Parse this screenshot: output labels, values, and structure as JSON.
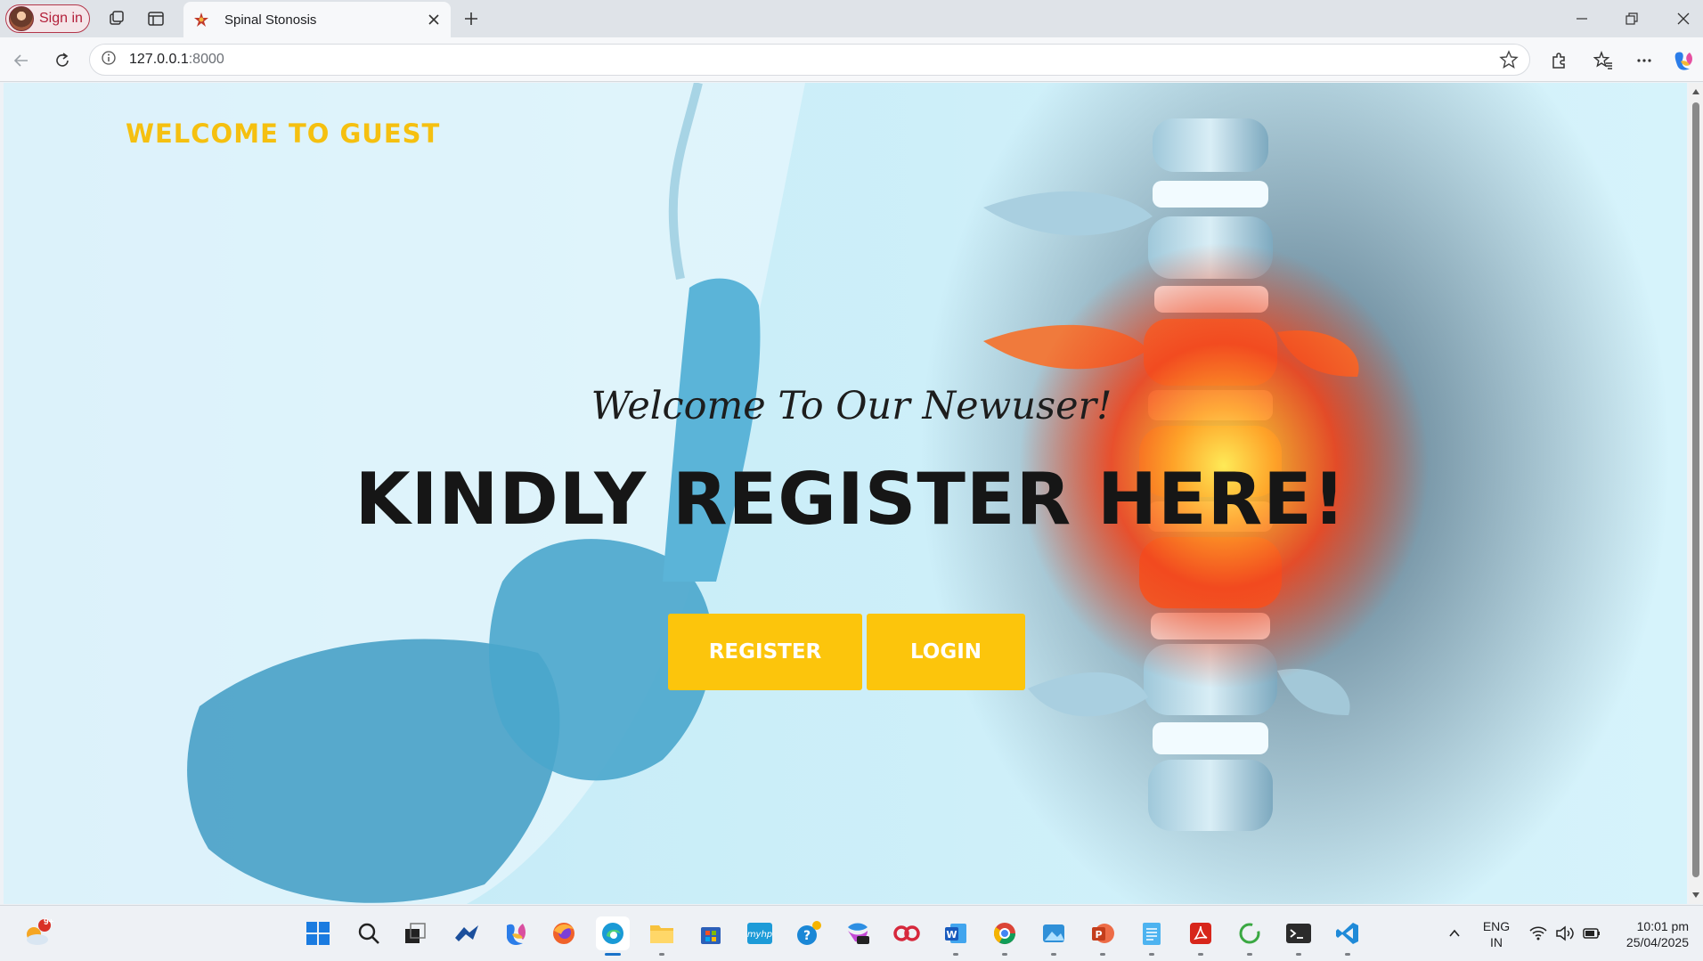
{
  "browser": {
    "profile_label": "Sign in",
    "tab_title": "Spinal Stonosis",
    "url_host": "127.0.0.1",
    "url_port": ":8000"
  },
  "page": {
    "welcome_guest": "WELCOME TO GUEST",
    "tagline": "Welcome To Our Newuser!",
    "headline": "KINDLY REGISTER HERE!",
    "register_label": "REGISTER",
    "login_label": "LOGIN",
    "accent_color": "#fcc50c"
  },
  "taskbar": {
    "weather_badge": "9+",
    "language_line1": "ENG",
    "language_line2": "IN",
    "time": "10:01 pm",
    "date": "25/04/2025",
    "apps": [
      "start-icon",
      "search-icon",
      "task-view-icon",
      "widgets-icon",
      "copilot-icon",
      "firefox-icon",
      "edge-icon",
      "file-explorer-icon",
      "store-icon",
      "myhp-icon",
      "help-icon",
      "m365-icon",
      "codeium-icon",
      "word-icon",
      "chrome-icon",
      "photos-icon",
      "powerpoint-icon",
      "notepad-icon",
      "acrobat-icon",
      "refresh-app-icon",
      "terminal-icon",
      "vscode-icon"
    ]
  }
}
